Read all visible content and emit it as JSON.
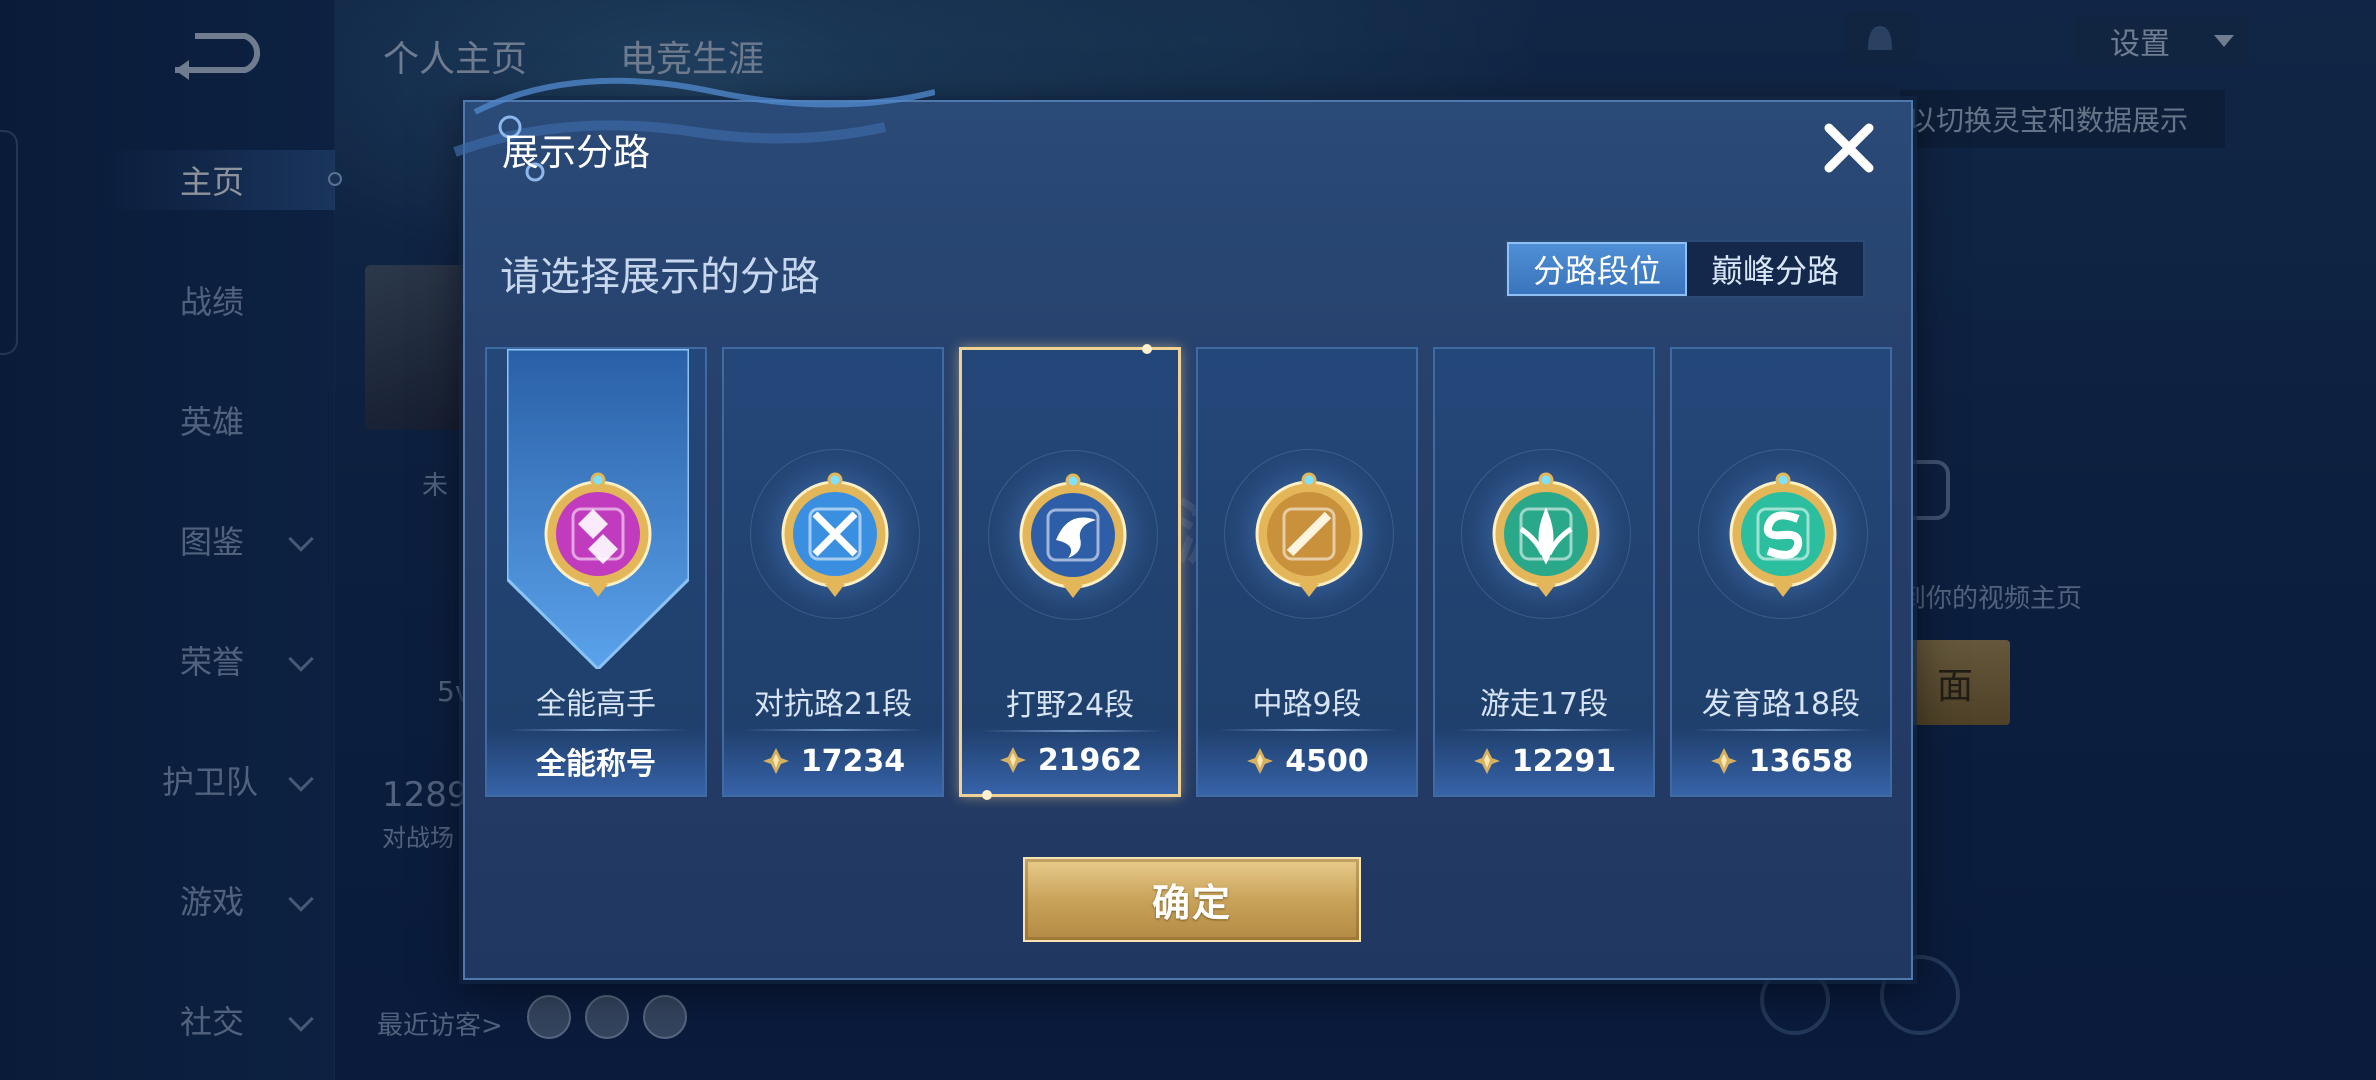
{
  "background": {
    "top_tabs": [
      "个人主页",
      "电竞生涯"
    ],
    "settings_label": "设置",
    "hint_text": "以切换灵宝和数据展示",
    "nav": [
      {
        "label": "主页",
        "active": true,
        "expandable": false
      },
      {
        "label": "战绩",
        "active": false,
        "expandable": false
      },
      {
        "label": "英雄",
        "active": false,
        "expandable": false
      },
      {
        "label": "图鉴",
        "active": false,
        "expandable": true
      },
      {
        "label": "荣誉",
        "active": false,
        "expandable": true
      },
      {
        "label": "护卫队",
        "active": false,
        "expandable": true
      },
      {
        "label": "游戏",
        "active": false,
        "expandable": true
      },
      {
        "label": "社交",
        "active": false,
        "expandable": true
      }
    ],
    "partial_texts": {
      "status": "未",
      "level": "5v",
      "count": "1289",
      "battle": "对战场",
      "visitors": "最近访客>",
      "video": "到你的视频主页",
      "gold_btn": "面"
    }
  },
  "modal": {
    "title": "展示分路",
    "subtitle": "请选择展示的分路",
    "toggle": [
      {
        "label": "分路段位",
        "selected": true
      },
      {
        "label": "巅峰分路",
        "selected": false
      }
    ],
    "cards": [
      {
        "name": "全能高手",
        "footer": "全能称号",
        "show_gem": false,
        "selected": false,
        "color": "#c13bbf"
      },
      {
        "name": "对抗路21段",
        "footer": "17234",
        "show_gem": true,
        "selected": false,
        "color": "#3a8fe0"
      },
      {
        "name": "打野24段",
        "footer": "21962",
        "show_gem": true,
        "selected": true,
        "color": "#2f5ea8"
      },
      {
        "name": "中路9段",
        "footer": "4500",
        "show_gem": true,
        "selected": false,
        "color": "#c9913b"
      },
      {
        "name": "游走17段",
        "footer": "12291",
        "show_gem": true,
        "selected": false,
        "color": "#2aa88a"
      },
      {
        "name": "发育路18段",
        "footer": "13658",
        "show_gem": true,
        "selected": false,
        "color": "#2bbf9f"
      }
    ],
    "confirm_label": "确定",
    "watermark": "手游"
  },
  "colors": {
    "gold_accent": "#f0d394",
    "modal_bg": "#2a4a78"
  }
}
